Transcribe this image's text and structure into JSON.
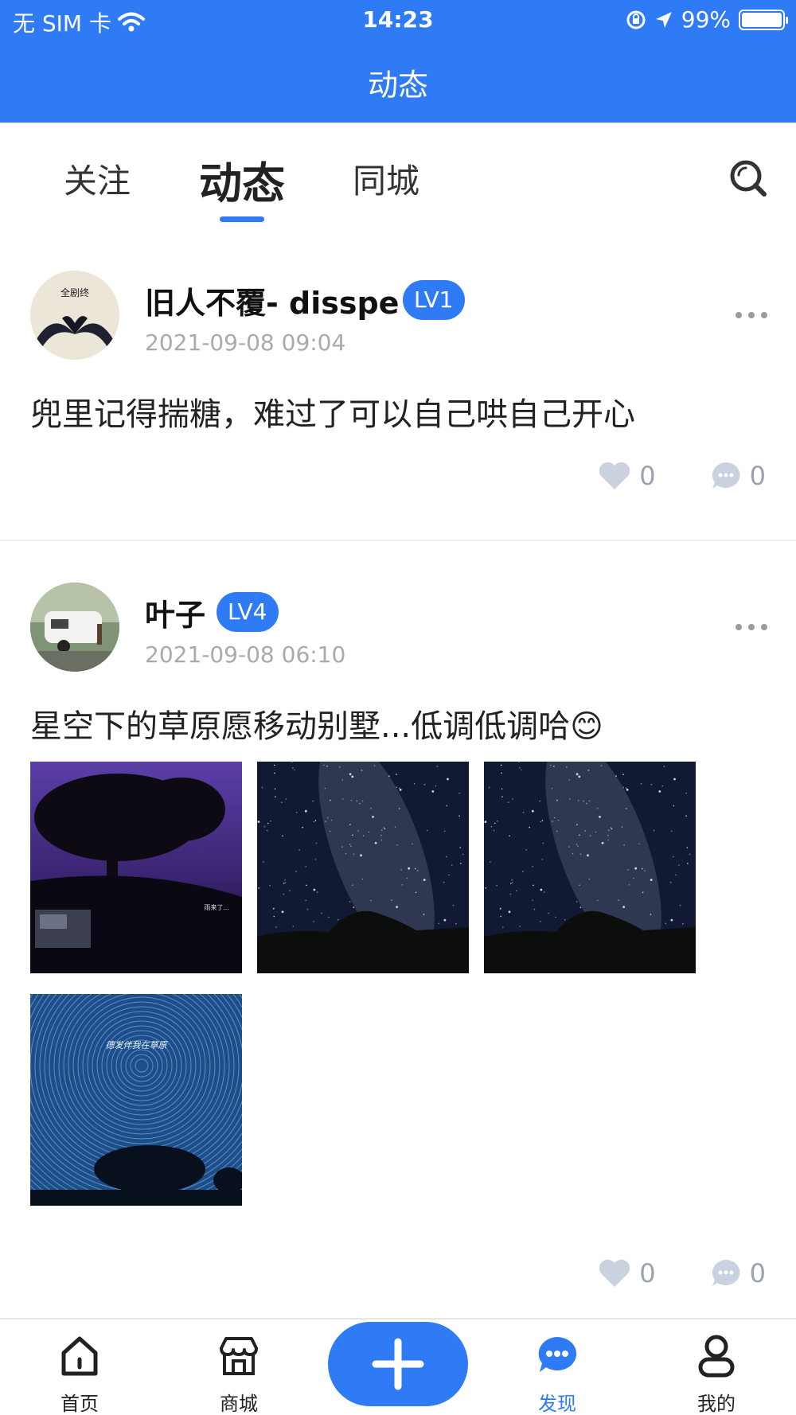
{
  "status_bar": {
    "carrier": "无 SIM 卡",
    "time": "14:23",
    "battery_text": "99%",
    "battery_level": 0.99
  },
  "header": {
    "title": "动态"
  },
  "tabs": [
    {
      "label": "关注",
      "active": false
    },
    {
      "label": "动态",
      "active": true
    },
    {
      "label": "同城",
      "active": false
    }
  ],
  "posts": [
    {
      "username": "旧人不覆- disspe",
      "level": "LV1",
      "time": "2021-09-08 09:04",
      "content": "兜里记得揣糖，难过了可以自己哄自己开心",
      "likes": "0",
      "comments": "0",
      "avatar_text_top": "全剧终"
    },
    {
      "username": "叶子",
      "level": "LV4",
      "time": "2021-09-08 06:10",
      "content": "星空下的草原愿移动别墅...低调低调哈😊",
      "likes": "0",
      "comments": "0",
      "images": [
        {
          "caption": "雨来了..."
        },
        {
          "caption": ""
        },
        {
          "caption": ""
        },
        {
          "caption": "德发伴我在草原"
        }
      ]
    }
  ],
  "bottom_nav": [
    {
      "label": "首页",
      "icon": "home-icon",
      "active": false
    },
    {
      "label": "商城",
      "icon": "store-icon",
      "active": false
    },
    {
      "label": "",
      "icon": "plus-icon",
      "active": false
    },
    {
      "label": "发现",
      "icon": "chat-bubble-icon",
      "active": true
    },
    {
      "label": "我的",
      "icon": "user-icon",
      "active": false
    }
  ],
  "colors": {
    "primary": "#2f7bf5",
    "muted": "#9aa3ad",
    "time": "#aaaaaa"
  }
}
